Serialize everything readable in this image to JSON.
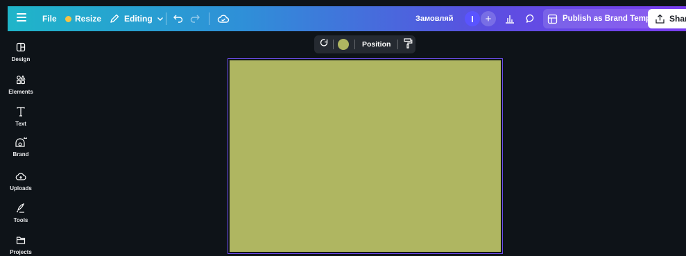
{
  "topbar": {
    "file_label": "File",
    "resize_label": "Resize",
    "editing_label": "Editing",
    "project_name": "Замовляй",
    "avatar_initial": "I",
    "plus_label": "+",
    "publish_label": "Publish as Brand Template",
    "share_label": "Share"
  },
  "sidebar": {
    "items": [
      {
        "label": "Design",
        "icon": "design-icon"
      },
      {
        "label": "Elements",
        "icon": "elements-icon"
      },
      {
        "label": "Text",
        "icon": "text-icon"
      },
      {
        "label": "Brand",
        "icon": "brand-icon"
      },
      {
        "label": "Uploads",
        "icon": "uploads-icon"
      },
      {
        "label": "Tools",
        "icon": "tools-icon"
      },
      {
        "label": "Projects",
        "icon": "projects-icon"
      }
    ]
  },
  "context_toolbar": {
    "position_label": "Position",
    "fill_color": "#afb661"
  },
  "canvas": {
    "background_color": "#afb661",
    "selection_color": "#6b4ce8"
  },
  "colors": {
    "app_background": "#0e1318",
    "gradient_start": "#1fb5c9",
    "gradient_end": "#7b3ff0"
  }
}
